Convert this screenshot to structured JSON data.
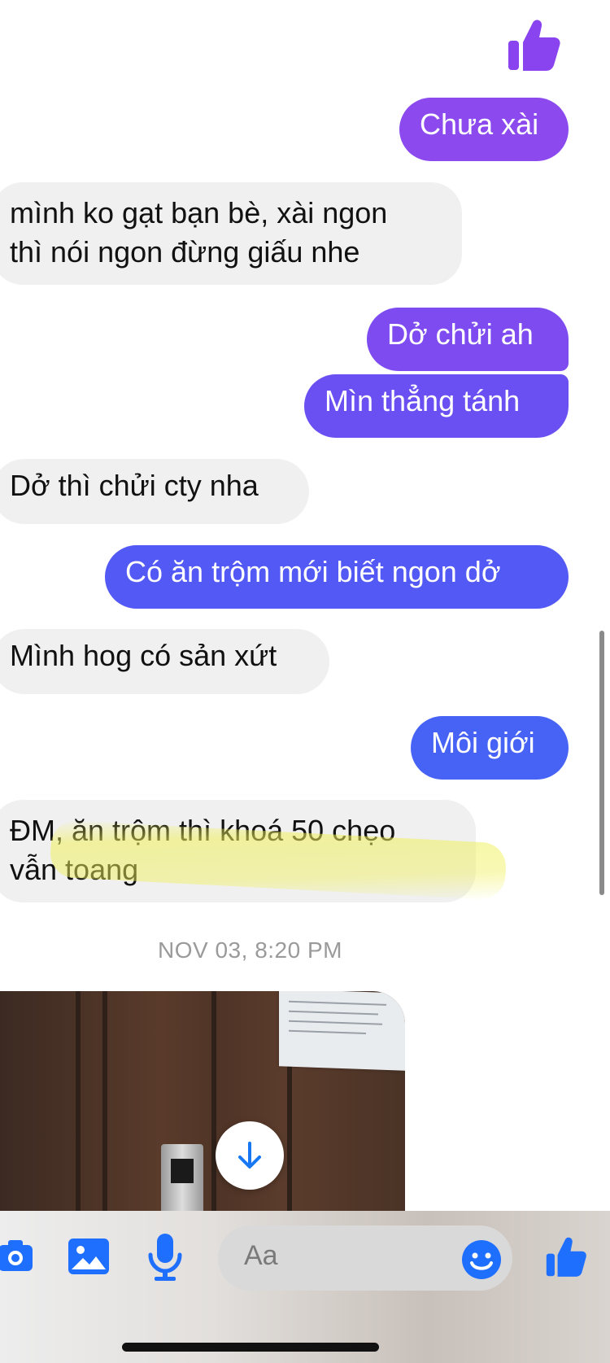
{
  "messages": [
    {
      "id": "b1",
      "side": "out",
      "text": "Chưa xài"
    },
    {
      "id": "b2",
      "side": "in",
      "lines": [
        "mình ko gạt bạn bè, xài ngon",
        "thì nói ngon đừng giấu nhe"
      ]
    },
    {
      "id": "b3",
      "side": "out",
      "text": "Dở chửi ah"
    },
    {
      "id": "b4",
      "side": "out",
      "text": "Mìn thẳng tánh"
    },
    {
      "id": "b5",
      "side": "in",
      "text": "Dở thì chửi cty nha"
    },
    {
      "id": "b6",
      "side": "out",
      "text": "Có ăn trộm mới biết ngon dở"
    },
    {
      "id": "b7",
      "side": "in",
      "text": "Mình hog có sản xứt"
    },
    {
      "id": "b8",
      "side": "out",
      "text": "Môi giới"
    },
    {
      "id": "b9",
      "side": "in",
      "lines": [
        "ĐM, ăn trộm thì khoá 50 chẹo",
        "vẫn toang"
      ]
    }
  ],
  "timestamp": "NOV 03, 8:20 PM",
  "composer": {
    "placeholder": "Aa",
    "icons": [
      "camera-icon",
      "image-icon",
      "microphone-icon",
      "emoji-icon",
      "thumbs-up-icon"
    ]
  },
  "colors": {
    "accent": "#8b49ee",
    "like_blue": "#1f6fff",
    "incoming_bubble": "#f0f0f0"
  }
}
